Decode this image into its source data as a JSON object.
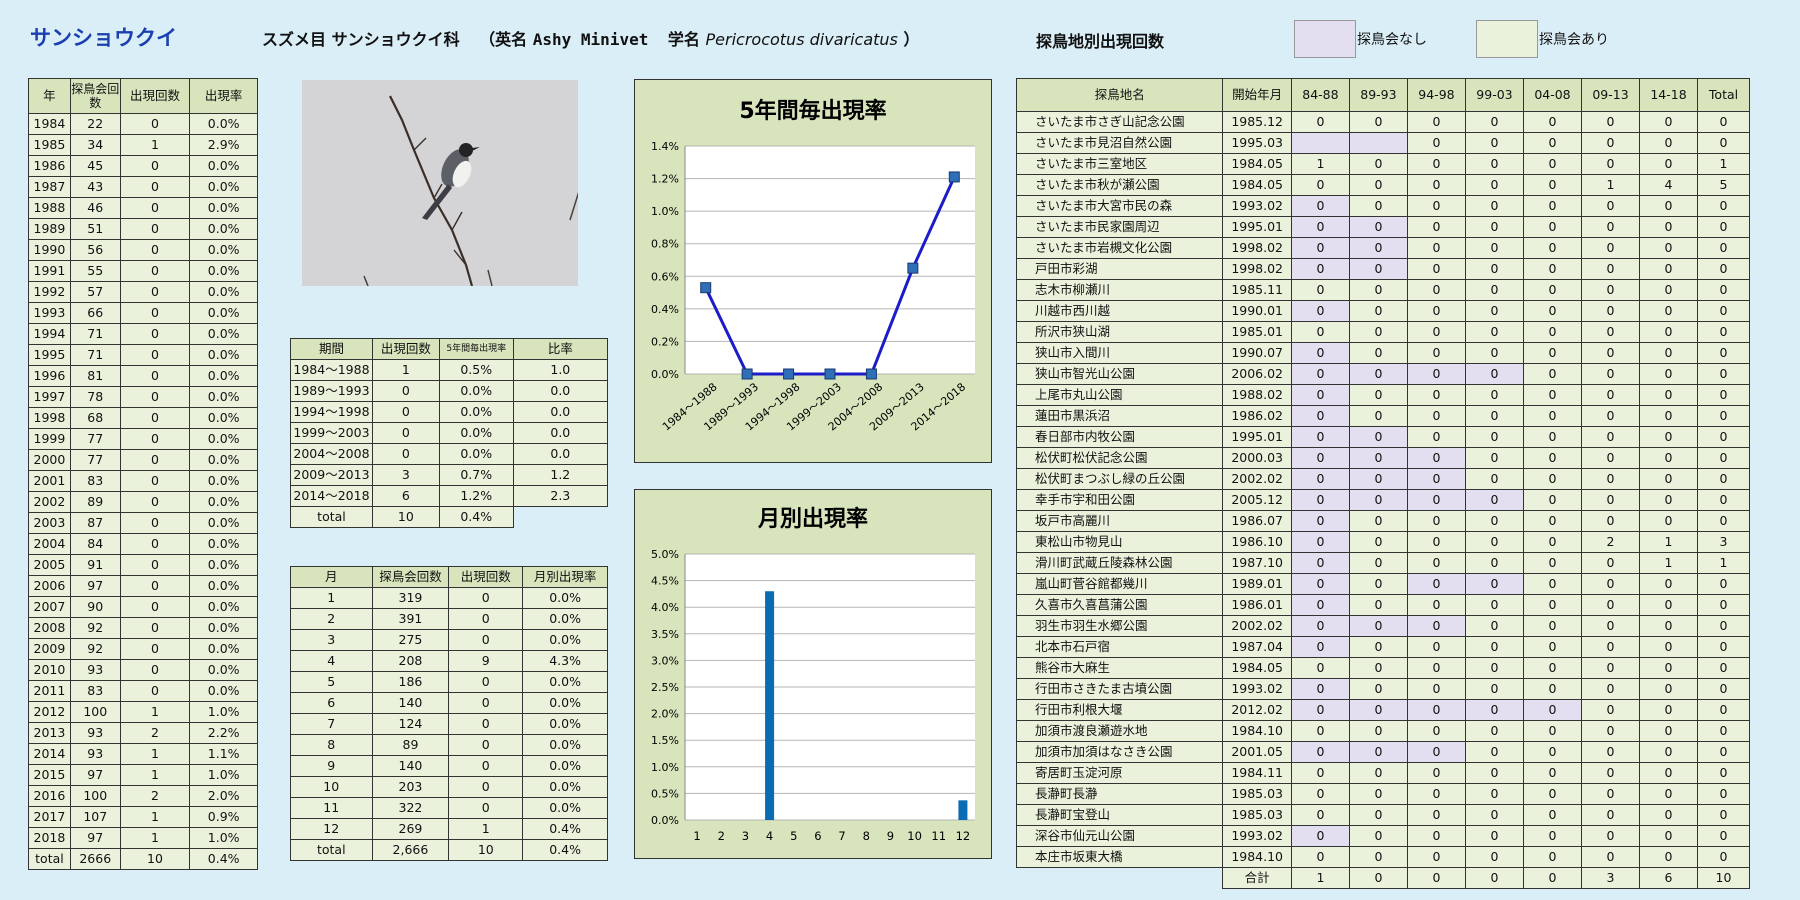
{
  "page_title": "サンショウクイ",
  "header": {
    "order_family": "スズメ目 サンショウクイ科",
    "english_label": "（英名",
    "english_name": "Ashy Minivet",
    "scientific_label": "学名",
    "scientific_name": "Pericrocotus divaricatus",
    "close_paren": "）",
    "site_title": "探鳥地別出現回数"
  },
  "legend": [
    {
      "label": "探鳥会なし",
      "color": "#e4dff0"
    },
    {
      "label": "探鳥会あり",
      "color": "#ebf2dc"
    }
  ],
  "year_table": {
    "headers": [
      "年",
      "探鳥会回数",
      "出現回数",
      "出現率"
    ],
    "rows": [
      [
        "1984",
        "22",
        "0",
        "0.0%"
      ],
      [
        "1985",
        "34",
        "1",
        "2.9%"
      ],
      [
        "1986",
        "45",
        "0",
        "0.0%"
      ],
      [
        "1987",
        "43",
        "0",
        "0.0%"
      ],
      [
        "1988",
        "46",
        "0",
        "0.0%"
      ],
      [
        "1989",
        "51",
        "0",
        "0.0%"
      ],
      [
        "1990",
        "56",
        "0",
        "0.0%"
      ],
      [
        "1991",
        "55",
        "0",
        "0.0%"
      ],
      [
        "1992",
        "57",
        "0",
        "0.0%"
      ],
      [
        "1993",
        "66",
        "0",
        "0.0%"
      ],
      [
        "1994",
        "71",
        "0",
        "0.0%"
      ],
      [
        "1995",
        "71",
        "0",
        "0.0%"
      ],
      [
        "1996",
        "81",
        "0",
        "0.0%"
      ],
      [
        "1997",
        "78",
        "0",
        "0.0%"
      ],
      [
        "1998",
        "68",
        "0",
        "0.0%"
      ],
      [
        "1999",
        "77",
        "0",
        "0.0%"
      ],
      [
        "2000",
        "77",
        "0",
        "0.0%"
      ],
      [
        "2001",
        "83",
        "0",
        "0.0%"
      ],
      [
        "2002",
        "89",
        "0",
        "0.0%"
      ],
      [
        "2003",
        "87",
        "0",
        "0.0%"
      ],
      [
        "2004",
        "84",
        "0",
        "0.0%"
      ],
      [
        "2005",
        "91",
        "0",
        "0.0%"
      ],
      [
        "2006",
        "97",
        "0",
        "0.0%"
      ],
      [
        "2007",
        "90",
        "0",
        "0.0%"
      ],
      [
        "2008",
        "92",
        "0",
        "0.0%"
      ],
      [
        "2009",
        "92",
        "0",
        "0.0%"
      ],
      [
        "2010",
        "93",
        "0",
        "0.0%"
      ],
      [
        "2011",
        "83",
        "0",
        "0.0%"
      ],
      [
        "2012",
        "100",
        "1",
        "1.0%"
      ],
      [
        "2013",
        "93",
        "2",
        "2.2%"
      ],
      [
        "2014",
        "93",
        "1",
        "1.1%"
      ],
      [
        "2015",
        "97",
        "1",
        "1.0%"
      ],
      [
        "2016",
        "100",
        "2",
        "2.0%"
      ],
      [
        "2017",
        "107",
        "1",
        "0.9%"
      ],
      [
        "2018",
        "97",
        "1",
        "1.0%"
      ]
    ],
    "total": [
      "total",
      "2666",
      "10",
      "0.4%"
    ]
  },
  "period_table": {
    "headers": [
      "期間",
      "出現回数",
      "5年間毎出現率",
      "比率"
    ],
    "rows": [
      [
        "1984～1988",
        "1",
        "0.5%",
        "1.0"
      ],
      [
        "1989～1993",
        "0",
        "0.0%",
        "0.0"
      ],
      [
        "1994～1998",
        "0",
        "0.0%",
        "0.0"
      ],
      [
        "1999～2003",
        "0",
        "0.0%",
        "0.0"
      ],
      [
        "2004～2008",
        "0",
        "0.0%",
        "0.0"
      ],
      [
        "2009～2013",
        "3",
        "0.7%",
        "1.2"
      ],
      [
        "2014～2018",
        "6",
        "1.2%",
        "2.3"
      ]
    ],
    "total": [
      "total",
      "10",
      "0.4%"
    ]
  },
  "month_table": {
    "headers": [
      "月",
      "探鳥会回数",
      "出現回数",
      "月別出現率"
    ],
    "rows": [
      [
        "1",
        "319",
        "0",
        "0.0%"
      ],
      [
        "2",
        "391",
        "0",
        "0.0%"
      ],
      [
        "3",
        "275",
        "0",
        "0.0%"
      ],
      [
        "4",
        "208",
        "9",
        "4.3%"
      ],
      [
        "5",
        "186",
        "0",
        "0.0%"
      ],
      [
        "6",
        "140",
        "0",
        "0.0%"
      ],
      [
        "7",
        "124",
        "0",
        "0.0%"
      ],
      [
        "8",
        "89",
        "0",
        "0.0%"
      ],
      [
        "9",
        "140",
        "0",
        "0.0%"
      ],
      [
        "10",
        "203",
        "0",
        "0.0%"
      ],
      [
        "11",
        "322",
        "0",
        "0.0%"
      ],
      [
        "12",
        "269",
        "1",
        "0.4%"
      ]
    ],
    "total": [
      "total",
      "2,666",
      "10",
      "0.4%"
    ]
  },
  "chart_data": [
    {
      "type": "line",
      "title": "5年間毎出現率",
      "categories": [
        "1984～1988",
        "1989～1993",
        "1994～1998",
        "1999～2003",
        "2004～2008",
        "2009～2013",
        "2014～2018"
      ],
      "values": [
        0.53,
        0.0,
        0.0,
        0.0,
        0.0,
        0.65,
        1.21
      ],
      "yticks": [
        "0.0%",
        "0.2%",
        "0.4%",
        "0.6%",
        "0.8%",
        "1.0%",
        "1.2%",
        "1.4%"
      ],
      "ylim": [
        0,
        1.4
      ],
      "grid": true,
      "series_color": "#1c1cc8",
      "marker_color": "#2e6fb8"
    },
    {
      "type": "bar",
      "title": "月別出現率",
      "categories": [
        "1",
        "2",
        "3",
        "4",
        "5",
        "6",
        "7",
        "8",
        "9",
        "10",
        "11",
        "12"
      ],
      "values": [
        0,
        0,
        0,
        4.3,
        0,
        0,
        0,
        0,
        0,
        0,
        0,
        0.37
      ],
      "yticks": [
        "0.0%",
        "0.5%",
        "1.0%",
        "1.5%",
        "2.0%",
        "2.5%",
        "3.0%",
        "3.5%",
        "4.0%",
        "4.5%",
        "5.0%"
      ],
      "ylim": [
        0,
        5.0
      ],
      "grid": true,
      "bar_color": "#0b6bb5"
    }
  ],
  "site_table": {
    "headers": [
      "探鳥地名",
      "開始年月",
      "84-88",
      "89-93",
      "94-98",
      "99-03",
      "04-08",
      "09-13",
      "14-18",
      "Total"
    ],
    "rows": [
      {
        "cells": [
          "さいたま市さぎ山記念公園",
          "1985.12",
          "0",
          "0",
          "0",
          "0",
          "0",
          "0",
          "0",
          "0"
        ],
        "none": []
      },
      {
        "cells": [
          "さいたま市見沼自然公園",
          "1995.03",
          "",
          "",
          "0",
          "0",
          "0",
          "0",
          "0",
          "0"
        ],
        "none": [
          0,
          1
        ]
      },
      {
        "cells": [
          "さいたま市三室地区",
          "1984.05",
          "1",
          "0",
          "0",
          "0",
          "0",
          "0",
          "0",
          "1"
        ],
        "none": []
      },
      {
        "cells": [
          "さいたま市秋が瀬公園",
          "1984.05",
          "0",
          "0",
          "0",
          "0",
          "0",
          "1",
          "4",
          "5"
        ],
        "none": []
      },
      {
        "cells": [
          "さいたま市大宮市民の森",
          "1993.02",
          "0",
          "0",
          "0",
          "0",
          "0",
          "0",
          "0",
          "0"
        ],
        "none": [
          0
        ]
      },
      {
        "cells": [
          "さいたま市民家園周辺",
          "1995.01",
          "0",
          "0",
          "0",
          "0",
          "0",
          "0",
          "0",
          "0"
        ],
        "none": [
          0,
          1
        ]
      },
      {
        "cells": [
          "さいたま市岩槻文化公園",
          "1998.02",
          "0",
          "0",
          "0",
          "0",
          "0",
          "0",
          "0",
          "0"
        ],
        "none": [
          0,
          1
        ]
      },
      {
        "cells": [
          "戸田市彩湖",
          "1998.02",
          "0",
          "0",
          "0",
          "0",
          "0",
          "0",
          "0",
          "0"
        ],
        "none": [
          0,
          1
        ]
      },
      {
        "cells": [
          "志木市柳瀬川",
          "1985.11",
          "0",
          "0",
          "0",
          "0",
          "0",
          "0",
          "0",
          "0"
        ],
        "none": []
      },
      {
        "cells": [
          "川越市西川越",
          "1990.01",
          "0",
          "0",
          "0",
          "0",
          "0",
          "0",
          "0",
          "0"
        ],
        "none": [
          0
        ]
      },
      {
        "cells": [
          "所沢市狭山湖",
          "1985.01",
          "0",
          "0",
          "0",
          "0",
          "0",
          "0",
          "0",
          "0"
        ],
        "none": []
      },
      {
        "cells": [
          "狭山市入間川",
          "1990.07",
          "0",
          "0",
          "0",
          "0",
          "0",
          "0",
          "0",
          "0"
        ],
        "none": [
          0
        ]
      },
      {
        "cells": [
          "狭山市智光山公園",
          "2006.02",
          "0",
          "0",
          "0",
          "0",
          "0",
          "0",
          "0",
          "0"
        ],
        "none": [
          0,
          1,
          2,
          3
        ]
      },
      {
        "cells": [
          "上尾市丸山公園",
          "1988.02",
          "0",
          "0",
          "0",
          "0",
          "0",
          "0",
          "0",
          "0"
        ],
        "none": [
          0
        ]
      },
      {
        "cells": [
          "蓮田市黒浜沼",
          "1986.02",
          "0",
          "0",
          "0",
          "0",
          "0",
          "0",
          "0",
          "0"
        ],
        "none": [
          0
        ]
      },
      {
        "cells": [
          "春日部市内牧公園",
          "1995.01",
          "0",
          "0",
          "0",
          "0",
          "0",
          "0",
          "0",
          "0"
        ],
        "none": [
          0,
          1
        ]
      },
      {
        "cells": [
          "松伏町松伏記念公園",
          "2000.03",
          "0",
          "0",
          "0",
          "0",
          "0",
          "0",
          "0",
          "0"
        ],
        "none": [
          0,
          1,
          2
        ]
      },
      {
        "cells": [
          "松伏町まつぶし緑の丘公園",
          "2002.02",
          "0",
          "0",
          "0",
          "0",
          "0",
          "0",
          "0",
          "0"
        ],
        "none": [
          0,
          1,
          2
        ]
      },
      {
        "cells": [
          "幸手市宇和田公園",
          "2005.12",
          "0",
          "0",
          "0",
          "0",
          "0",
          "0",
          "0",
          "0"
        ],
        "none": [
          0,
          1,
          2,
          3
        ]
      },
      {
        "cells": [
          "坂戸市高麗川",
          "1986.07",
          "0",
          "0",
          "0",
          "0",
          "0",
          "0",
          "0",
          "0"
        ],
        "none": [
          0
        ]
      },
      {
        "cells": [
          "東松山市物見山",
          "1986.10",
          "0",
          "0",
          "0",
          "0",
          "0",
          "2",
          "1",
          "3"
        ],
        "none": [
          0
        ]
      },
      {
        "cells": [
          "滑川町武蔵丘陵森林公園",
          "1987.10",
          "0",
          "0",
          "0",
          "0",
          "0",
          "0",
          "1",
          "1"
        ],
        "none": [
          0
        ]
      },
      {
        "cells": [
          "嵐山町菅谷館都幾川",
          "1989.01",
          "0",
          "0",
          "0",
          "0",
          "0",
          "0",
          "0",
          "0"
        ],
        "none": [
          0,
          2,
          3
        ]
      },
      {
        "cells": [
          "久喜市久喜菖蒲公園",
          "1986.01",
          "0",
          "0",
          "0",
          "0",
          "0",
          "0",
          "0",
          "0"
        ],
        "none": [
          0
        ]
      },
      {
        "cells": [
          "羽生市羽生水郷公園",
          "2002.02",
          "0",
          "0",
          "0",
          "0",
          "0",
          "0",
          "0",
          "0"
        ],
        "none": [
          0,
          1,
          2
        ]
      },
      {
        "cells": [
          "北本市石戸宿",
          "1987.04",
          "0",
          "0",
          "0",
          "0",
          "0",
          "0",
          "0",
          "0"
        ],
        "none": [
          0
        ]
      },
      {
        "cells": [
          "熊谷市大麻生",
          "1984.05",
          "0",
          "0",
          "0",
          "0",
          "0",
          "0",
          "0",
          "0"
        ],
        "none": []
      },
      {
        "cells": [
          "行田市さきたま古墳公園",
          "1993.02",
          "0",
          "0",
          "0",
          "0",
          "0",
          "0",
          "0",
          "0"
        ],
        "none": [
          0
        ]
      },
      {
        "cells": [
          "行田市利根大堰",
          "2012.02",
          "0",
          "0",
          "0",
          "0",
          "0",
          "0",
          "0",
          "0"
        ],
        "none": [
          0,
          1,
          2,
          3,
          4
        ]
      },
      {
        "cells": [
          "加須市渡良瀬遊水地",
          "1984.10",
          "0",
          "0",
          "0",
          "0",
          "0",
          "0",
          "0",
          "0"
        ],
        "none": []
      },
      {
        "cells": [
          "加須市加須はなさき公園",
          "2001.05",
          "0",
          "0",
          "0",
          "0",
          "0",
          "0",
          "0",
          "0"
        ],
        "none": [
          0,
          1,
          2
        ]
      },
      {
        "cells": [
          "寄居町玉淀河原",
          "1984.11",
          "0",
          "0",
          "0",
          "0",
          "0",
          "0",
          "0",
          "0"
        ],
        "none": []
      },
      {
        "cells": [
          "長瀞町長瀞",
          "1985.03",
          "0",
          "0",
          "0",
          "0",
          "0",
          "0",
          "0",
          "0"
        ],
        "none": []
      },
      {
        "cells": [
          "長瀞町宝登山",
          "1985.03",
          "0",
          "0",
          "0",
          "0",
          "0",
          "0",
          "0",
          "0"
        ],
        "none": []
      },
      {
        "cells": [
          "深谷市仙元山公園",
          "1993.02",
          "0",
          "0",
          "0",
          "0",
          "0",
          "0",
          "0",
          "0"
        ],
        "none": [
          0
        ]
      },
      {
        "cells": [
          "本庄市坂東大橋",
          "1984.10",
          "0",
          "0",
          "0",
          "0",
          "0",
          "0",
          "0",
          "0"
        ],
        "none": []
      }
    ],
    "total": [
      "合計",
      "1",
      "0",
      "0",
      "0",
      "0",
      "3",
      "6",
      "10"
    ]
  }
}
